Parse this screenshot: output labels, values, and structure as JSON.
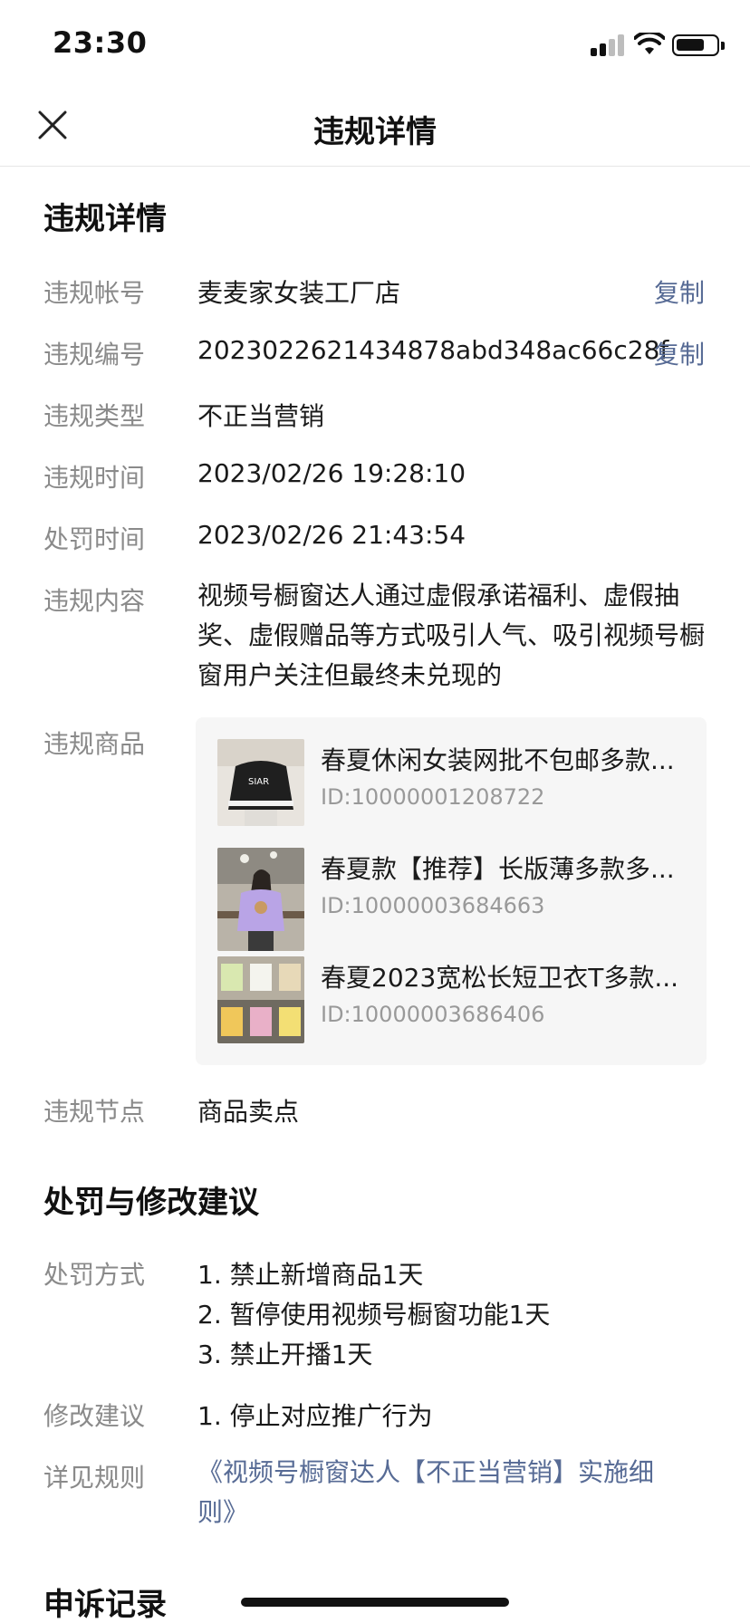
{
  "status_bar": {
    "time": "23:30"
  },
  "nav": {
    "title": "违规详情"
  },
  "details": {
    "heading": "违规详情",
    "account": {
      "label": "违规帐号",
      "value": "麦麦家女装工厂店",
      "copy": "复制"
    },
    "number": {
      "label": "违规编号",
      "value": "2023022621434878abd348ac66c28f",
      "copy": "复制"
    },
    "type": {
      "label": "违规类型",
      "value": "不正当营销"
    },
    "violation_time": {
      "label": "违规时间",
      "value": "2023/02/26 19:28:10"
    },
    "penalty_time": {
      "label": "处罚时间",
      "value": "2023/02/26 21:43:54"
    },
    "content": {
      "label": "违规内容",
      "value": "视频号橱窗达人通过虚假承诺福利、虚假抽奖、虚假赠品等方式吸引人气、吸引视频号橱窗用户关注但最终未兑现的"
    },
    "products": {
      "label": "违规商品",
      "items": [
        {
          "name": "春夏休闲女装网批不包邮多款...",
          "id": "ID:10000001208722"
        },
        {
          "name": "春夏款【推荐】长版薄多款多...",
          "id": "ID:10000003684663"
        },
        {
          "name": "春夏2023宽松长短卫衣T多款...",
          "id": "ID:10000003686406"
        }
      ]
    },
    "node": {
      "label": "违规节点",
      "value": "商品卖点"
    }
  },
  "penalty": {
    "heading": "处罚与修改建议",
    "method": {
      "label": "处罚方式",
      "lines": [
        "1. 禁止新增商品1天",
        "2. 暂停使用视频号橱窗功能1天",
        "3. 禁止开播1天"
      ]
    },
    "suggestion": {
      "label": "修改建议",
      "value": "1. 停止对应推广行为"
    },
    "rules": {
      "label": "详见规则",
      "link": "《视频号橱窗达人【不正当营销】实施细则》"
    }
  },
  "appeal": {
    "heading": "申诉记录"
  },
  "icons": {
    "close": "close-icon",
    "signal": "cellular-signal-icon",
    "wifi": "wifi-icon",
    "battery": "battery-icon"
  },
  "colors": {
    "link": "#576b95",
    "label": "#8a8a8a",
    "product_bg": "#f6f6f6"
  }
}
